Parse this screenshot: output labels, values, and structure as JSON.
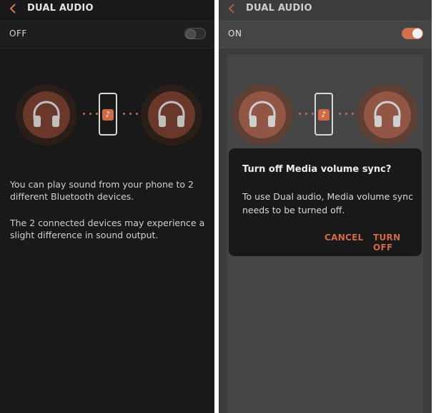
{
  "left": {
    "header": {
      "title": "DUAL AUDIO"
    },
    "toggle": {
      "label": "OFF",
      "state": "off"
    },
    "description": [
      "You can play sound from your phone to 2 different Bluetooth devices.",
      "The 2 connected devices may experience a slight difference in sound output."
    ]
  },
  "right": {
    "header": {
      "title": "DUAL AUDIO"
    },
    "toggle": {
      "label": "ON",
      "state": "on"
    },
    "dialog": {
      "title": "Turn off Media volume sync?",
      "body": "To use Dual audio, Media volume sync needs to be turned off.",
      "cancel_label": "CANCEL",
      "confirm_label": "TURN OFF"
    }
  },
  "illustration": {
    "music_glyph": "♪"
  },
  "colors": {
    "accent": "#d06a46",
    "left_bg": "#191919",
    "right_bg": "#3c3c3c",
    "dialog_bg": "#191919"
  }
}
